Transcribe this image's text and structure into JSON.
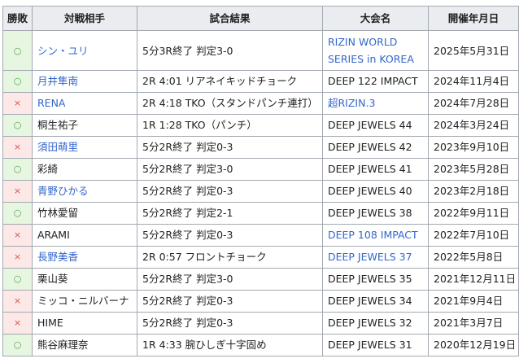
{
  "headers": [
    "勝敗",
    "対戦相手",
    "試合結果",
    "大会名",
    "開催年月日"
  ],
  "rows": [
    {
      "result": "win",
      "mark": "○",
      "opponent": "シン・ユリ",
      "opponent_link": true,
      "outcome": "5分3R終了 判定3-0",
      "event_line1": "RIZIN WORLD",
      "event_line2": "SERIES in KOREA",
      "event_link": true,
      "date": "2025年5月31日"
    },
    {
      "result": "win",
      "mark": "○",
      "opponent": "月井隼南",
      "opponent_link": true,
      "outcome": "2R 4:01 リアネイキッドチョーク",
      "event": "DEEP 122 IMPACT",
      "event_link": false,
      "date": "2024年11月4日"
    },
    {
      "result": "loss",
      "mark": "×",
      "opponent": "RENA",
      "opponent_link": true,
      "outcome": "2R 4:18 TKO（スタンドパンチ連打）",
      "event": "超RIZIN.3",
      "event_link": true,
      "date": "2024年7月28日"
    },
    {
      "result": "win",
      "mark": "○",
      "opponent": "桐生祐子",
      "opponent_link": false,
      "outcome": "1R 1:28 TKO（パンチ）",
      "event": "DEEP JEWELS 44",
      "event_link": false,
      "date": "2024年3月24日"
    },
    {
      "result": "loss",
      "mark": "×",
      "opponent": "須田萌里",
      "opponent_link": true,
      "outcome": "5分2R終了 判定0-3",
      "event": "DEEP JEWELS 42",
      "event_link": false,
      "date": "2023年9月10日"
    },
    {
      "result": "win",
      "mark": "○",
      "opponent": "彩綺",
      "opponent_link": false,
      "outcome": "5分2R終了 判定3-0",
      "event": "DEEP JEWELS 41",
      "event_link": false,
      "date": "2023年5月28日"
    },
    {
      "result": "loss",
      "mark": "×",
      "opponent": "青野ひかる",
      "opponent_link": true,
      "outcome": "5分2R終了 判定0-3",
      "event": "DEEP JEWELS 40",
      "event_link": false,
      "date": "2023年2月18日"
    },
    {
      "result": "win",
      "mark": "○",
      "opponent": "竹林愛留",
      "opponent_link": false,
      "outcome": "5分2R終了 判定2-1",
      "event": "DEEP JEWELS 38",
      "event_link": false,
      "date": "2022年9月11日"
    },
    {
      "result": "loss",
      "mark": "×",
      "opponent": "ARAMI",
      "opponent_link": false,
      "outcome": "5分2R終了 判定0-3",
      "event": "DEEP 108 IMPACT",
      "event_link": true,
      "date": "2022年7月10日"
    },
    {
      "result": "loss",
      "mark": "×",
      "opponent": "長野美香",
      "opponent_link": true,
      "outcome": "2R 0:57 フロントチョーク",
      "event": "DEEP JEWELS 37",
      "event_link": true,
      "date": "2022年5月8日"
    },
    {
      "result": "win",
      "mark": "○",
      "opponent": "栗山葵",
      "opponent_link": false,
      "outcome": "5分2R終了 判定3-0",
      "event": "DEEP JEWELS 35",
      "event_link": false,
      "date": "2021年12月11日"
    },
    {
      "result": "loss",
      "mark": "×",
      "opponent": "ミッコ・ニルバーナ",
      "opponent_link": false,
      "outcome": "5分2R終了 判定0-3",
      "event": "DEEP JEWELS 34",
      "event_link": false,
      "date": "2021年9月4日"
    },
    {
      "result": "loss",
      "mark": "×",
      "opponent": "HIME",
      "opponent_link": false,
      "outcome": "5分2R終了 判定0-3",
      "event": "DEEP JEWELS 32",
      "event_link": false,
      "date": "2021年3月7日"
    },
    {
      "result": "win",
      "mark": "○",
      "opponent": "熊谷麻理奈",
      "opponent_link": false,
      "outcome": "1R 4:33 腕ひしぎ十字固め",
      "event": "DEEP JEWELS 31",
      "event_link": false,
      "date": "2020年12月19日"
    }
  ],
  "colors": {
    "link": "#3366cc",
    "win_bg": "#e6f6e1",
    "loss_bg": "#fde8e8",
    "header_bg": "#eaecf0",
    "border": "#a2a9b1"
  }
}
